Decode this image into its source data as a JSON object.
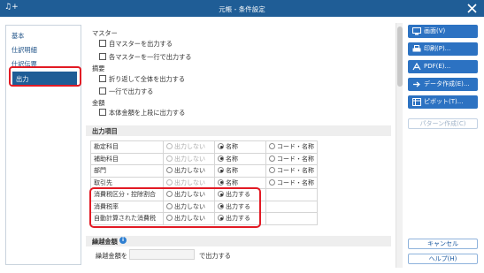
{
  "window": {
    "title": "元帳 - 条件設定",
    "app_icon_glyph": "♫+"
  },
  "nav": {
    "items": [
      {
        "label": "基本"
      },
      {
        "label": "仕訳明細"
      },
      {
        "label": "仕訳伝票"
      },
      {
        "label": "出力"
      }
    ],
    "active_index": 3
  },
  "master": {
    "heading": "マスター",
    "options": [
      "自マスターを出力する",
      "各マスターを一行で出力する"
    ]
  },
  "tekiyo": {
    "heading": "摘要",
    "options": [
      "折り返して全体を出力する",
      "一行で出力する"
    ]
  },
  "kingaku": {
    "heading": "金額",
    "options": [
      "本体金額を上段に出力する"
    ]
  },
  "output_items": {
    "heading": "出力項目",
    "rows": [
      {
        "name": "勘定科目",
        "opt1": "出力しない",
        "opt2": "名称",
        "opt3": "コード・名称",
        "opt1_disabled": true
      },
      {
        "name": "補助科目",
        "opt1": "出力しない",
        "opt2": "名称",
        "opt3": "コード・名称",
        "opt1_disabled": true
      },
      {
        "name": "部門",
        "opt1": "出力しない",
        "opt2": "名称",
        "opt3": "コード・名称",
        "opt1_disabled": false
      },
      {
        "name": "取引先",
        "opt1": "出力しない",
        "opt2": "名称",
        "opt3": "コード・名称",
        "opt1_disabled": true
      },
      {
        "name": "消費税区分・控除割合",
        "opt1": "出力しない",
        "opt2": "出力する",
        "opt3": ""
      },
      {
        "name": "消費税率",
        "opt1": "出力しない",
        "opt2": "出力する",
        "opt3": ""
      },
      {
        "name": "自動計算された消費税",
        "opt1": "出力しない",
        "opt2": "出力する",
        "opt3": ""
      }
    ]
  },
  "carryover": {
    "heading": "繰越金額",
    "label_before": "繰越金額を",
    "value": "",
    "label_after": "で出力する"
  },
  "buttons": {
    "screen": "画面(V)",
    "print": "印刷(P)...",
    "pdf": "PDF(E)...",
    "data": "データ作成(E)...",
    "pivot": "ピボット(T)...",
    "pattern": "パターン作成(C)",
    "cancel": "キャンセル",
    "help": "ヘルプ(H)"
  },
  "colors": {
    "titlebar": "#1f5d96",
    "accent": "#2c72c2",
    "highlight": "#e21a24"
  }
}
